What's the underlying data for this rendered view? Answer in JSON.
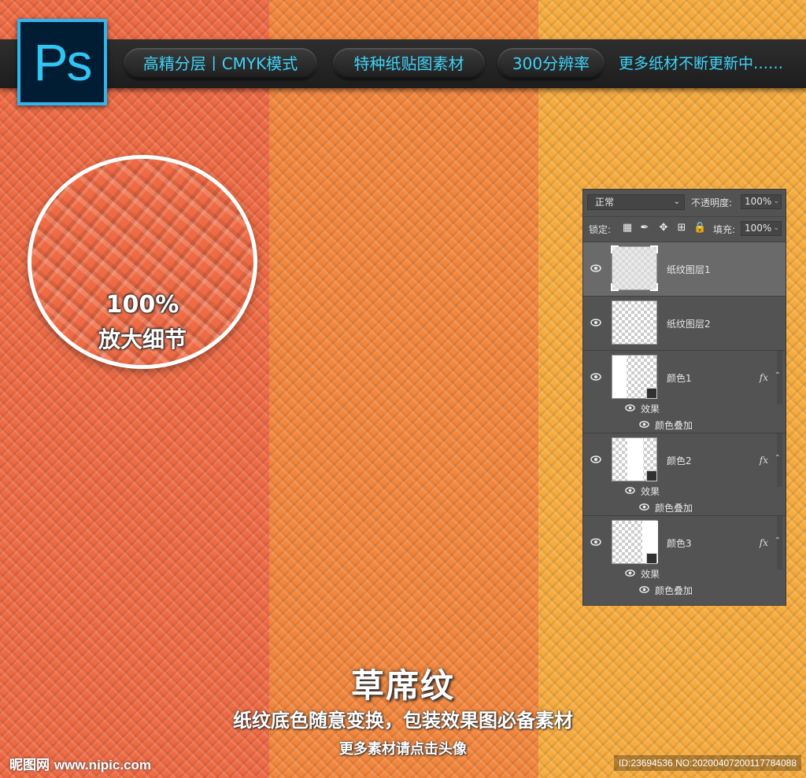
{
  "banner": {
    "logo_text": "Ps",
    "pills": [
      "高精分层丨CMYK模式",
      "特种纸贴图素材",
      "300分辨率"
    ],
    "tail": "更多纸材不断更新中……"
  },
  "zoom": {
    "percent": "100%",
    "label": "放大细节"
  },
  "colors": {
    "strip_red": "#ee6a44",
    "strip_orange": "#f2863d",
    "strip_yellow": "#f5ab3e",
    "accent_cyan": "#3fd2f8",
    "panel_bg": "#535353"
  },
  "layers_panel": {
    "blend_mode": "正常",
    "opacity_label": "不透明度:",
    "opacity_value": "100%",
    "lock_label": "锁定:",
    "fill_label": "填充:",
    "fill_value": "100%",
    "lock_icons": [
      "checkerboard-lock-icon",
      "brush-lock-icon",
      "move-lock-icon",
      "crop-lock-icon",
      "padlock-icon"
    ],
    "layers": [
      {
        "name": "纸纹图层1",
        "selected": true
      },
      {
        "name": "纸纹图层2",
        "selected": false
      },
      {
        "name": "颜色1",
        "fx": "fx",
        "effects_label": "效果",
        "effect": "颜色叠加"
      },
      {
        "name": "颜色2",
        "fx": "fx",
        "effects_label": "效果",
        "effect": "颜色叠加"
      },
      {
        "name": "颜色3",
        "fx": "fx",
        "effects_label": "效果",
        "effect": "颜色叠加"
      }
    ]
  },
  "caption": {
    "title": "草席纹",
    "subtitle": "纸纹底色随意变换，包装效果图必备素材",
    "note": "更多素材请点击头像"
  },
  "watermark": {
    "brand": "昵图网",
    "site": "www.nipic.com",
    "id_text": "ID:23694536 NO:20200407200117784088"
  }
}
